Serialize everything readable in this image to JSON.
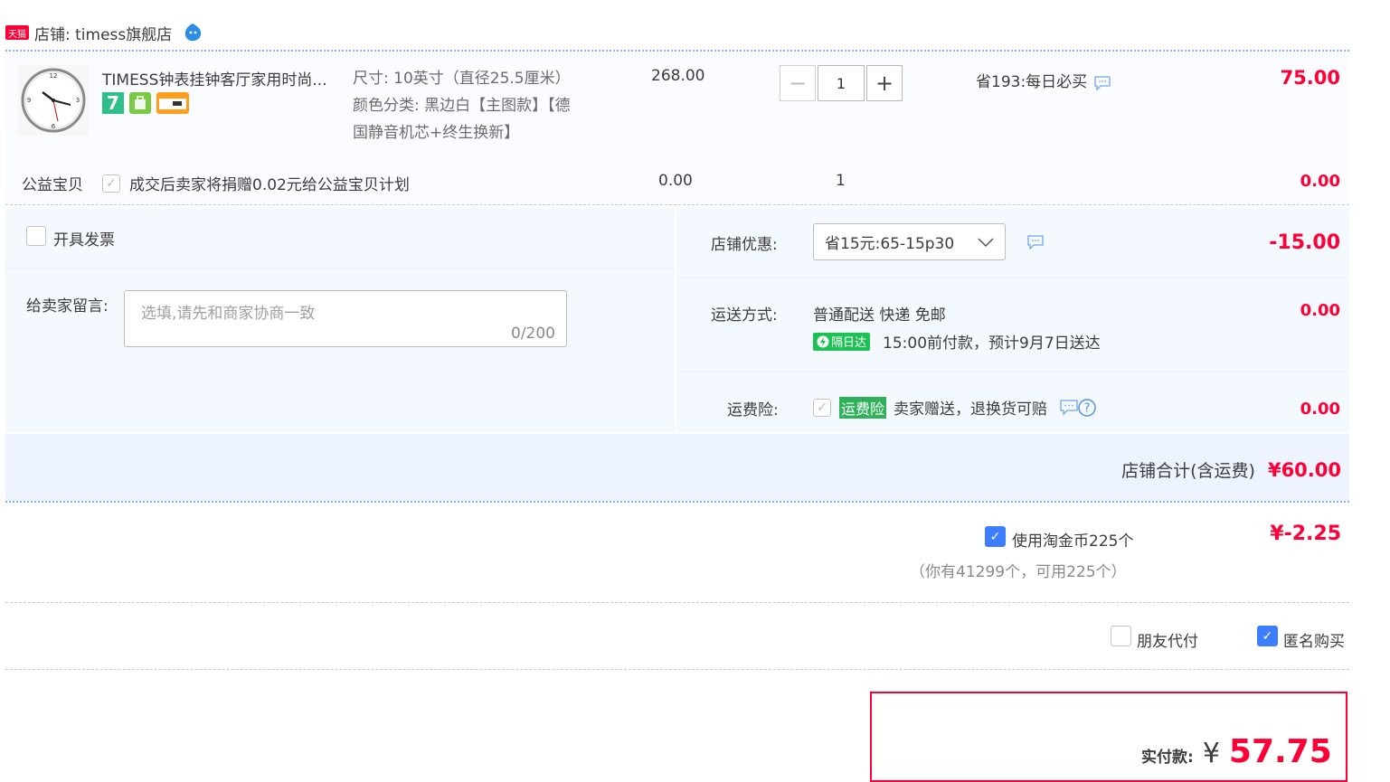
{
  "shop": {
    "badge": "天猫",
    "name": "店铺: timess旗舰店"
  },
  "item": {
    "title": "TIMESS钟表挂钟客厅家用时尚...",
    "spec_size": "尺寸: 10英寸（直径25.5厘米）",
    "spec_color_1": "颜色分类: 黑边白【主图款】【德",
    "spec_color_2": "国静音机芯+终生换新】",
    "unit_price": "268.00",
    "quantity": "1",
    "promo": "省193:每日必买",
    "amount": "75.00",
    "badge_7": "7"
  },
  "charity": {
    "label": "公益宝贝",
    "text": "成交后卖家将捐赠0.02元给公益宝贝计划",
    "price": "0.00",
    "qty": "1",
    "amount": "0.00"
  },
  "invoice": {
    "label": "开具发票"
  },
  "message": {
    "label": "给卖家留言:",
    "placeholder": "选填,请先和商家协商一致",
    "counter": "0/200"
  },
  "discount": {
    "label": "店铺优惠:",
    "selected": "省15元:65-15p30",
    "amount": "-15.00"
  },
  "shipping": {
    "label": "运送方式:",
    "method": "普通配送 快递 免邮",
    "badge": "隔日达",
    "eta": "15:00前付款，预计9月7日送达",
    "amount": "0.00"
  },
  "insurance": {
    "label": "运费险:",
    "badge": "运费险",
    "text": "卖家赠送，退换货可赔",
    "amount": "0.00"
  },
  "shop_total": {
    "label": "店铺合计(含运费)",
    "amount": "¥60.00"
  },
  "coins": {
    "label": "使用淘金币225个",
    "note": "（你有41299个，可用225个）",
    "amount": "¥-2.25"
  },
  "options": {
    "friend_pay": "朋友代付",
    "anonymous": "匿名购买"
  },
  "pay": {
    "label": "实付款:",
    "currency": "¥",
    "amount": "57.75"
  },
  "colors": {
    "accent_red": "#ff0036",
    "accent_blue": "#3d7eff",
    "panel_bg": "#eef4ff"
  }
}
